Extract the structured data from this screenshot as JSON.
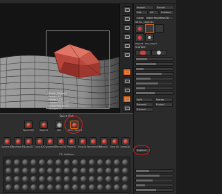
{
  "stats": [
    "SkinL_Object1",
    "Polys=12",
    "Points=17",
    "HiddenPolys=0",
    "ActivePoints=0",
    "Groups=1"
  ],
  "right_panel": {
    "top_buttons": [
      "Import",
      "Export",
      "Get",
      "All",
      "Subtool",
      "Clone",
      "Make PolyMesh3D"
    ],
    "tool_name": "SkinL_Object1",
    "thumb_labels": [
      "Object1",
      "Star_Object"
    ],
    "subtool_label": "SubTool",
    "highlighted_button": "Append",
    "bottom_buttons": [
      "Split",
      "Merge",
      "Remesh",
      "Project",
      "Extract"
    ]
  },
  "quick_pick": {
    "title": "Quick Pick",
    "row1": [
      "Sphere3D",
      "Object1",
      "Star",
      "Skin_Object1"
    ],
    "row1_selected_index": 3,
    "row2": [
      "Sphere3D",
      "PolyMesh3D",
      "Cube3D",
      "Cone3D",
      "Cylinder3D",
      "Terrain3D",
      "Plane3D",
      "Ring3D",
      "SphereInfo3D",
      "Helix3D",
      "Gear3D",
      "Arrow3D"
    ],
    "row3_title": "ZTL Additions"
  },
  "colors": {
    "accent": "#d9651f",
    "highlight_circle": "#e01a1a",
    "model": "#c4453b"
  }
}
